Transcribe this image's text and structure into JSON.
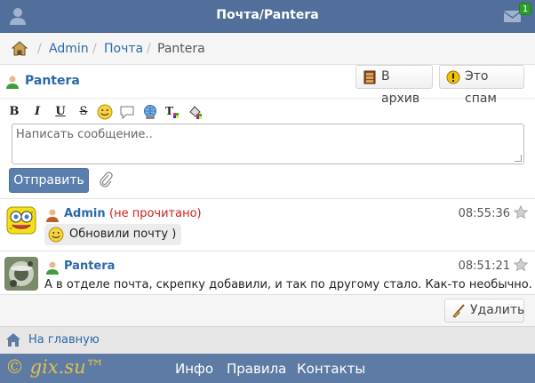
{
  "header": {
    "title": "Почта/Pantera",
    "mail_count": "1"
  },
  "breadcrumb": {
    "items": [
      "Admin",
      "Почта",
      "Pantera"
    ],
    "separator": "/"
  },
  "contact": {
    "name": "Pantera",
    "archive_label": "В архив",
    "spam_label": "Это спам"
  },
  "editor": {
    "tools": [
      "bold-tool",
      "italic-tool",
      "underline-tool",
      "strike-tool",
      "smiley-tool",
      "quote-tool",
      "link-tool",
      "translit-tool",
      "color-tool"
    ],
    "placeholder": "Написать сообщение..",
    "send_label": "Отправить"
  },
  "messages": [
    {
      "author": "Admin",
      "status": "(не прочитано)",
      "time": "08:55:36",
      "text": "Обновили почту )"
    },
    {
      "author": "Pantera",
      "status": "",
      "time": "08:51:21",
      "text": "А в отделе почта, скрепку добавили, и так по другому стало. Как-то необычно."
    }
  ],
  "actions": {
    "delete_label": "Удалить"
  },
  "home_link": "На главную",
  "footer": {
    "logo": "© gix.su™",
    "links": [
      "Инфо",
      "Правила",
      "Контакты"
    ]
  },
  "colors": {
    "header_bg": "#516f9a",
    "footer_bg": "#5d7ba4",
    "link": "#2a6aa8",
    "unread": "#cc1f1f",
    "send_button": "#5b7fac"
  }
}
